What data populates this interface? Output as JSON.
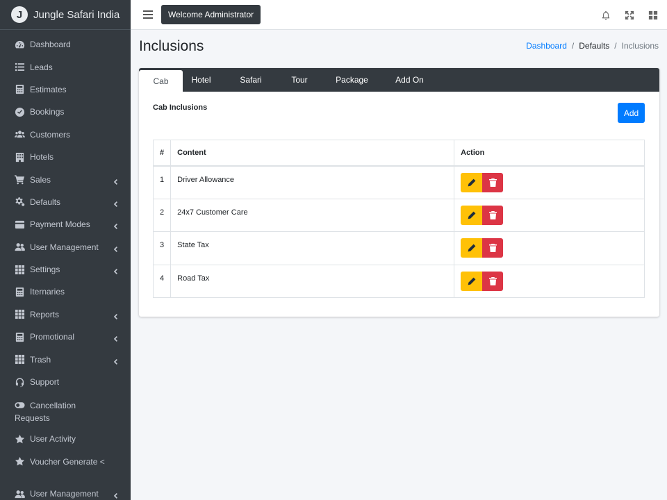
{
  "brand": {
    "logo_letter": "J",
    "name": "Jungle Safari India"
  },
  "sidebar": {
    "items": [
      {
        "label": "Dashboard",
        "icon": "tachometer-icon",
        "chevron": false
      },
      {
        "label": "Leads",
        "icon": "list-icon",
        "chevron": false
      },
      {
        "label": "Estimates",
        "icon": "calculator-icon",
        "chevron": false
      },
      {
        "label": "Bookings",
        "icon": "check-circle-icon",
        "chevron": false
      },
      {
        "label": "Customers",
        "icon": "users-icon",
        "chevron": false
      },
      {
        "label": "Hotels",
        "icon": "building-icon",
        "chevron": false
      },
      {
        "label": "Sales",
        "icon": "cart-icon",
        "chevron": true
      },
      {
        "label": "Defaults",
        "icon": "cogs-icon",
        "chevron": true
      },
      {
        "label": "Payment Modes",
        "icon": "credit-card-icon",
        "chevron": true
      },
      {
        "label": "User Management",
        "icon": "user-friends-icon",
        "chevron": true
      },
      {
        "label": "Settings",
        "icon": "grid-icon",
        "chevron": true
      },
      {
        "label": "Iternaries",
        "icon": "calculator-icon",
        "chevron": false
      },
      {
        "label": "Reports",
        "icon": "grid-icon",
        "chevron": true
      },
      {
        "label": "Promotional",
        "icon": "calculator-icon",
        "chevron": true
      },
      {
        "label": "Trash",
        "icon": "grid-icon",
        "chevron": true
      },
      {
        "label": "Support",
        "icon": "headset-icon",
        "chevron": false
      },
      {
        "label": "Cancellation Requests",
        "icon": "toggle-icon",
        "chevron": false
      },
      {
        "label": "User Activity",
        "icon": "star-icon",
        "chevron": false
      },
      {
        "label": "Voucher Generate <",
        "icon": "star-icon",
        "chevron": false
      },
      {
        "label": "User Management",
        "icon": "user-friends-icon",
        "chevron": true
      }
    ]
  },
  "topbar": {
    "welcome": "Welcome Administrator"
  },
  "page": {
    "title": "Inclusions"
  },
  "breadcrumb": {
    "home": "Dashboard",
    "parent": "Defaults",
    "current": "Inclusions",
    "separator": "/"
  },
  "tabs": [
    {
      "label": "Cab",
      "active": true
    },
    {
      "label": "Hotel",
      "active": false
    },
    {
      "label": "Safari",
      "active": false
    },
    {
      "label": "Tour",
      "active": false
    },
    {
      "label": "Package",
      "active": false
    },
    {
      "label": "Add On",
      "active": false
    }
  ],
  "section": {
    "title": "Cab Inclusions",
    "add_label": "Add"
  },
  "table": {
    "headers": [
      "#",
      "Content",
      "Action"
    ],
    "rows": [
      {
        "num": "1",
        "content": "Driver Allowance"
      },
      {
        "num": "2",
        "content": "24x7 Customer Care"
      },
      {
        "num": "3",
        "content": "State Tax"
      },
      {
        "num": "4",
        "content": "Road Tax"
      }
    ]
  },
  "colors": {
    "sidebar_bg": "#343a40",
    "primary": "#007bff",
    "warning": "#ffc107",
    "danger": "#dc3545"
  }
}
